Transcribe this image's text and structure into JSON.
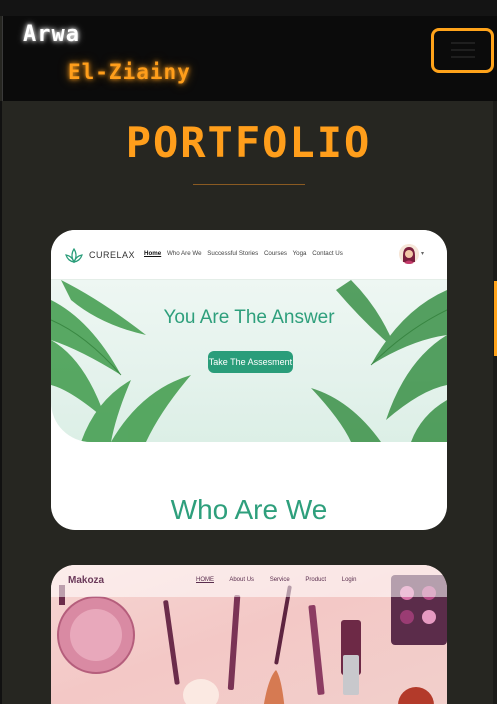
{
  "header": {
    "first_name": "Arwa",
    "last_name": "El-Ziainy",
    "menu_icon": "hamburger-icon",
    "accent_color": "#ffa31a"
  },
  "section": {
    "title": "PORTFOLIO"
  },
  "projects": [
    {
      "brand": "CURELAX",
      "nav_links": [
        "Home",
        "Who Are We",
        "Successful Stories",
        "Courses",
        "Yoga",
        "Contact Us"
      ],
      "active_link": "Home",
      "headline": "You Are The Answer",
      "cta_label": "Take The Assesment",
      "subheading": "Who Are We",
      "accent_color": "#2a9d7a"
    },
    {
      "brand": "Makoza",
      "nav_links": [
        "HOME",
        "About Us",
        "Service",
        "Product",
        "Login"
      ],
      "active_link": "HOME",
      "accent_color": "#6b3a5a"
    }
  ]
}
